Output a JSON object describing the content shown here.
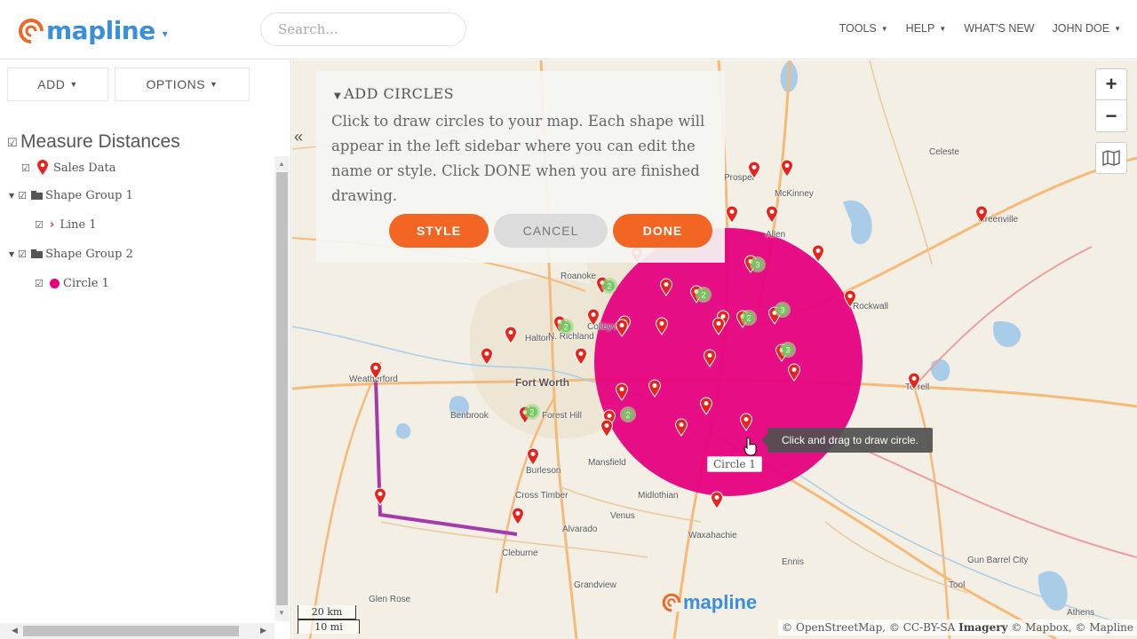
{
  "header": {
    "logo_text": "mapline",
    "search_placeholder": "Search...",
    "nav": [
      {
        "label": "TOOLS",
        "caret": true
      },
      {
        "label": "HELP",
        "caret": true
      },
      {
        "label": "WHAT'S NEW",
        "caret": false
      },
      {
        "label": "JOHN DOE",
        "caret": true
      }
    ]
  },
  "sidebar": {
    "add_label": "ADD",
    "options_label": "OPTIONS",
    "map_title": "Measure Distances",
    "tree": {
      "sales_data": "Sales Data",
      "shape_group_1": "Shape Group 1",
      "line_1": "Line 1",
      "shape_group_2": "Shape Group 2",
      "circle_1": "Circle 1"
    }
  },
  "panel": {
    "title": "ADD CIRCLES",
    "description": "Click to draw circles to your map. Each shape will appear in the left sidebar where you can edit the name or style. Click DONE when you are finished drawing.",
    "style_button": "STYLE",
    "cancel_button": "CANCEL",
    "done_button": "DONE"
  },
  "map": {
    "zoom_in": "+",
    "zoom_out": "−",
    "tooltip": "Click and drag to draw circle.",
    "circle_label": "Circle 1",
    "scale_km": "20 km",
    "scale_mi": "10 mi",
    "attribution_1": "© OpenStreetMap, © CC-BY-SA ",
    "attribution_imagery": "Imagery",
    "attribution_2": " © Mapbox, © Mapline",
    "watermark": "mapline",
    "places": [
      {
        "name": "Fort Worth"
      },
      {
        "name": "Weatherford"
      },
      {
        "name": "Benbrook"
      },
      {
        "name": "Forest Hill"
      },
      {
        "name": "Haltom"
      },
      {
        "name": "Roanoke"
      },
      {
        "name": "Mansfield"
      },
      {
        "name": "Burleson"
      },
      {
        "name": "Cross Timber"
      },
      {
        "name": "Midlothian"
      },
      {
        "name": "Venus"
      },
      {
        "name": "Alvarado"
      },
      {
        "name": "Cleburne"
      },
      {
        "name": "Waxahachie"
      },
      {
        "name": "Ennis"
      },
      {
        "name": "Grandview"
      },
      {
        "name": "Glen Rose"
      },
      {
        "name": "Celeste"
      },
      {
        "name": "McKinney"
      },
      {
        "name": "Allen"
      },
      {
        "name": "Greenville"
      },
      {
        "name": "Terrell"
      },
      {
        "name": "Gun Barrel City"
      },
      {
        "name": "Tool"
      },
      {
        "name": "Athens"
      },
      {
        "name": "Prosper"
      },
      {
        "name": "N. Richland"
      },
      {
        "name": "Colleyville"
      },
      {
        "name": "Rockwall"
      }
    ],
    "clusters": [
      "2",
      "3",
      "2",
      "2",
      "2",
      "3",
      "3",
      "2",
      "2"
    ]
  },
  "colors": {
    "accent": "#f26522",
    "brand": "#3a8fd8",
    "circle": "#e6007e",
    "line": "#a53bab",
    "marker": "#e8231c"
  }
}
